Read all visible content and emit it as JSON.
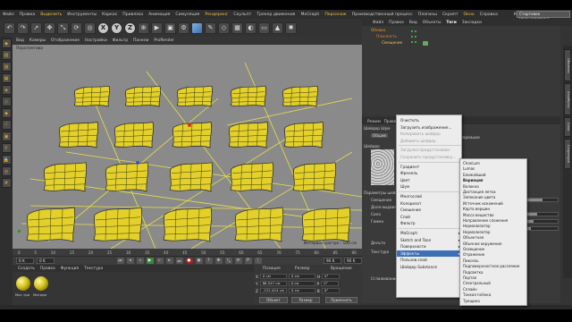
{
  "menubar": {
    "items": [
      "Файл",
      "Правка",
      "Выделить",
      "Инструменты",
      "Каркас",
      "Привязка",
      "Анимация",
      "Симуляция",
      "Рендеринг",
      "Скульпт",
      "Трекер движения",
      "MoGraph",
      "Персонаж",
      "Производственный процесс",
      "Плагины",
      "Скрипт",
      "Окно",
      "Справка"
    ],
    "highlighted": [
      "Выделить",
      "Рендеринг",
      "Персонаж",
      "Окно"
    ],
    "right_label": "Компоновка",
    "layout_value": "Стартовое (пользователь)"
  },
  "toolbar": {
    "axis_labels": [
      "X",
      "Y",
      "Z"
    ]
  },
  "viewport": {
    "menu": [
      "Вид",
      "Камеры",
      "Отображение",
      "Настройки",
      "Фильтр",
      "Панели",
      "ProRender"
    ],
    "label": "Перспектива",
    "grid_label": "Интервал растра : 100 см",
    "background": "#8a8a8a",
    "cloth_color": "#e3d02a"
  },
  "timeline": {
    "ticks": [
      "0",
      "5",
      "10",
      "15",
      "20",
      "25",
      "30",
      "35",
      "40",
      "45",
      "50",
      "55",
      "60",
      "65",
      "70",
      "75",
      "80",
      "85",
      "90"
    ],
    "start_value": "0 K",
    "current_value": "0 K",
    "end_value": "90 K",
    "end_value_2": "90 K",
    "frame_readout": "0 K"
  },
  "materials": {
    "menu": [
      "Создать",
      "Правка",
      "Функция",
      "Текстура"
    ],
    "items": [
      {
        "label": "Мат.три"
      },
      {
        "label": "Матери"
      }
    ]
  },
  "coords": {
    "headers": [
      "Позиция",
      "Размер",
      "Вращение"
    ],
    "rows": [
      {
        "axis": "X",
        "pos": "0 см",
        "size": "0 см",
        "rot_label": "H",
        "rot": "0°"
      },
      {
        "axis": "Y",
        "pos": "86.547 см",
        "size": "0 см",
        "rot_label": "P",
        "rot": "0°"
      },
      {
        "axis": "Z",
        "pos": "-122.424 см",
        "size": "0 см",
        "rot_label": "B",
        "rot": "0°"
      }
    ],
    "mode_button": "Объект",
    "size_button": "Размер",
    "apply_button": "Применить"
  },
  "rightpanel": {
    "menu": [
      "Файл",
      "Правка",
      "Вид",
      "Объекты",
      "Теги",
      "Закладки"
    ],
    "menu_highlighted": "Теги",
    "objects": [
      {
        "name": "Облако",
        "color": "#e0a030"
      },
      {
        "name": "Плоскость",
        "color": "#e08030"
      },
      {
        "name": "Смещение",
        "color": "#f0c040"
      }
    ],
    "attr_tabs": [
      "Режим",
      "Правка",
      "Пользователь"
    ],
    "attr_labels": {
      "shader_title": "Шейдер Шум",
      "basic": "Общие",
      "shader": "Шейдер",
      "params": "Параметры шей",
      "offset": "Смещение",
      "height_range": "Доля выдавл",
      "strength": "Сила",
      "gamma": "Гамма",
      "delta": "Дельта",
      "texture": "Текстура",
      "variation": "Вариации",
      "smoothing": "Сглаживание"
    },
    "values": {
      "offset_pct": 56,
      "strength_pct": 40
    }
  },
  "context_menu": {
    "items": [
      {
        "label": "Очистить",
        "disabled": false
      },
      {
        "label": "Загрузить изображение...",
        "disabled": false
      },
      {
        "label": "Копировать шейдер",
        "disabled": true
      },
      {
        "label": "Добавить шейдер",
        "disabled": true
      },
      {
        "sep": true
      },
      {
        "label": "Загрузка предустановки",
        "disabled": true
      },
      {
        "label": "Сохранить предустановку...",
        "disabled": true
      },
      {
        "sep": true
      },
      {
        "label": "Градиент",
        "disabled": false
      },
      {
        "label": "Френель",
        "disabled": false
      },
      {
        "label": "Цвет",
        "disabled": false
      },
      {
        "label": "Шум",
        "disabled": false
      },
      {
        "sep": true
      },
      {
        "label": "Многослой",
        "disabled": false
      },
      {
        "label": "Колоризат",
        "disabled": false
      },
      {
        "label": "Смешение",
        "disabled": false
      },
      {
        "label": "Слой",
        "disabled": false
      },
      {
        "label": "Фильтр",
        "disabled": false
      },
      {
        "sep": true
      },
      {
        "label": "MoGraph",
        "disabled": false,
        "arrow": true
      },
      {
        "label": "Sketch and Toon",
        "disabled": false,
        "arrow": true
      },
      {
        "label": "Поверхности",
        "disabled": false,
        "arrow": true
      },
      {
        "label": "Эффекты",
        "disabled": false,
        "arrow": true,
        "selected": true
      },
      {
        "label": "Пользов.слой",
        "disabled": false
      },
      {
        "label": "Шейдер Substance",
        "disabled": false
      }
    ]
  },
  "submenu": {
    "items": [
      {
        "label": "ChanLum"
      },
      {
        "label": "Lumas"
      },
      {
        "label": "Ближайший"
      },
      {
        "label": "Вариация",
        "bold": true
      },
      {
        "label": "Волокна"
      },
      {
        "label": "Дистанция летка"
      },
      {
        "label": "Запекание цвета"
      },
      {
        "label": "Источник искажений"
      },
      {
        "label": "Карта вершин"
      },
      {
        "label": "Масса вещества"
      },
      {
        "label": "Направление сложения"
      },
      {
        "label": "Нормализатор"
      },
      {
        "label": "Нормализатор"
      },
      {
        "label": "Объектная"
      },
      {
        "label": "Обычное окружение"
      },
      {
        "label": "Освещение"
      },
      {
        "label": "Отражение"
      },
      {
        "label": "Пиксель"
      },
      {
        "label": "Подповерхностное рассеяние"
      },
      {
        "label": "Подсветка"
      },
      {
        "label": "Портал"
      },
      {
        "label": "Спектральный"
      },
      {
        "label": "Сплайн"
      },
      {
        "label": "Тонкая плёнка"
      },
      {
        "label": "Трещина"
      }
    ]
  },
  "sidetabs": [
    "Объекты",
    "Атрибуты",
    "Слои",
    "Структура"
  ]
}
